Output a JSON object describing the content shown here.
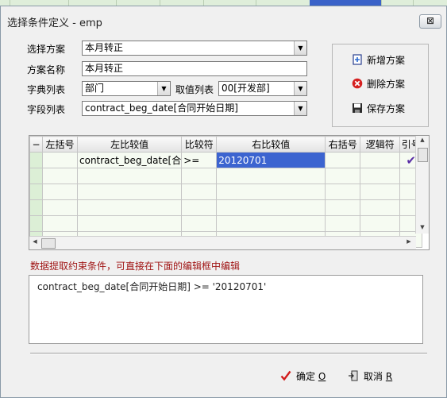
{
  "window": {
    "title": "选择条件定义 - emp",
    "close_label": "⊠"
  },
  "form": {
    "plan_select_label": "选择方案",
    "plan_select_value": "本月转正",
    "plan_name_label": "方案名称",
    "plan_name_value": "本月转正",
    "dict_list_label": "字典列表",
    "dict_list_value": "部门",
    "value_list_label": "取值列表",
    "value_list_value": "00[开发部]",
    "field_list_label": "字段列表",
    "field_list_value": "contract_beg_date[合同开始日期]"
  },
  "plan_buttons": {
    "add": "新增方案",
    "delete": "删除方案",
    "save": "保存方案"
  },
  "grid": {
    "corner": "−",
    "headers": [
      "左括号",
      "左比较值",
      "比较符",
      "右比较值",
      "右括号",
      "逻辑符",
      "引号"
    ],
    "row": {
      "left_bracket": "",
      "left_value": "contract_beg_date[合",
      "operator": ">=",
      "right_value": "20120701",
      "right_bracket": "",
      "logic": "",
      "quote_checked": "✔"
    }
  },
  "note": "数据提取约束条件，可直接在下面的编辑框中编辑",
  "expression": "contract_beg_date[合同开始日期]  >= '20120701'",
  "actions": {
    "ok_label": "确定",
    "ok_key": "O",
    "cancel_label": "取消",
    "cancel_key": "R"
  },
  "colors": {
    "selected_cell": "#3c64d0",
    "note_text": "#a01414",
    "check": "#5a2ea6"
  }
}
